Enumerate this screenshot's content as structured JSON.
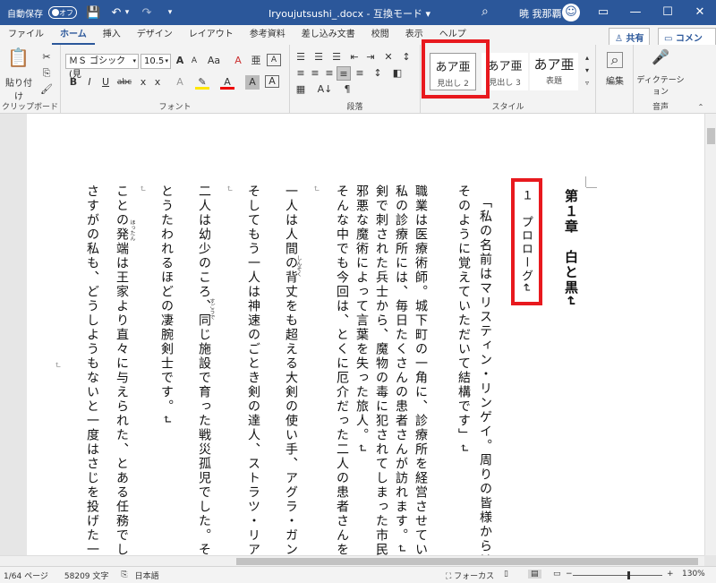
{
  "titlebar": {
    "autosave_label": "自動保存",
    "autosave_state": "オフ",
    "save_icon": "💾",
    "undo_icon": "↶",
    "undo_dropdown": "▾",
    "redo_icon": "↷",
    "customize_icon": "▾",
    "doc_title": "Iryoujutsushi_.docx  -  互換モード  ▾",
    "search_icon": "⌕",
    "user_name": "暁 我那覇",
    "avatar_icon": "☺",
    "ribbon_display_icon": "▭",
    "minimize_icon": "—",
    "maximize_icon": "☐",
    "close_icon": "✕"
  },
  "tabs": [
    "ファイル",
    "ホーム",
    "挿入",
    "デザイン",
    "レイアウト",
    "参考資料",
    "差し込み文書",
    "校閲",
    "表示",
    "ヘルプ"
  ],
  "active_tab": "ホーム",
  "share_label": "♙ 共有",
  "comment_label": "▭ コメント",
  "ribbon": {
    "clipboard": {
      "label": "クリップボード",
      "paste_label": "貼り付け",
      "paste_icon": "📋",
      "cut_icon": "✂",
      "copy_icon": "⎘",
      "format_painter_icon": "🖌"
    },
    "font": {
      "label": "フォント",
      "font_name": "ＭＳ ゴシック (見",
      "font_size": "10.5",
      "grow_icon": "A",
      "shrink_icon": "A",
      "case_icon": "Aa",
      "clear_icon": "A",
      "phonetic_icon": "亜",
      "bold": "B",
      "italic": "I",
      "underline": "U",
      "strike": "abc",
      "subscript": "x",
      "superscript": "x",
      "effects_icon": "A",
      "highlight_icon": "✎",
      "font_color_icon": "A",
      "shading_icon": "A",
      "border_icon": "A"
    },
    "paragraph": {
      "label": "段落",
      "bullets_icon": "☰",
      "numbering_icon": "☰",
      "multilevel_icon": "☰",
      "decrease_indent_icon": "⇤",
      "increase_indent_icon": "⇥",
      "chinese_layout_icon": "✕",
      "direction_icon": "↕",
      "align_top_icon": "≡",
      "align_center_icon": "≡",
      "align_bottom_icon": "≡",
      "justify_icon": "≡",
      "distribute_icon": "≡",
      "line_spacing_icon": "↕",
      "shading_icon": "◧",
      "border_icon": "▦",
      "sort_icon": "A↓",
      "show_marks_icon": "¶"
    },
    "styles": {
      "label": "スタイル",
      "items": [
        {
          "sample": "あア亜",
          "name": "見出し 2"
        },
        {
          "sample": "あア亜",
          "name": "見出し 3"
        },
        {
          "sample": "あア亜",
          "name": "表題"
        }
      ]
    },
    "editing": {
      "label": "編集",
      "icon": "⌕"
    },
    "voice": {
      "label": "音声",
      "dictate_label": "ディクテーション",
      "dictate_icon": "🎤"
    }
  },
  "document": {
    "heading": "第１章　白と黒↵",
    "subheading": "１　プロローグ↵",
    "paragraph_mark": "↵",
    "lines": [
      "「私の名前はマリスティン・リンゲイ。周りの皆様からはマリス",
      "そのように覚えていただいて結構です」↵",
      "職業は医療術師。城下町の一角に、診療所を経営させていただい",
      "私の診療所には、毎日たくさんの患者さんが訪れます。↵",
      "剣で刺された兵士から、魔物の毒に犯されてしまった市民。↵",
      "邪悪な魔術によって言葉を失った旅人。↵",
      "そんな中でも今回は、とくに厄介だった二人の患者さんをご紹介",
      "↵",
      "一人は人間の背丈をも超える大剣の使い手、アグラ・ガンマフェ",
      "そしてもう一人は神速のごとき剣の達人、ストラツ・リアノス。",
      "↵",
      "二人は幼少のころ、同じ施設で育った戦災孤児でした。そんな彼",
      "とうたわれるほどの凄腕剣士です。↵",
      "↵",
      "ことの発端は王家より直々に与えられた、とある任務でした。↵",
      "さすがの私も、どうしようもないと一度はさじを投げた一例です",
      "↵"
    ],
    "rubies": [
      "しんそく",
      "すごうで",
      "ほったん"
    ]
  },
  "statusbar": {
    "page": "1/64 ページ",
    "words": "58209 文字",
    "proof_icon": "⎘",
    "language": "日本語",
    "focus": "⛶ フォーカス",
    "read_mode_icon": "▯",
    "print_layout_icon": "▤",
    "web_layout_icon": "▭",
    "zoom_out": "−",
    "zoom_in": "+",
    "zoom": "130%",
    "zoom_fraction": 0.62
  }
}
